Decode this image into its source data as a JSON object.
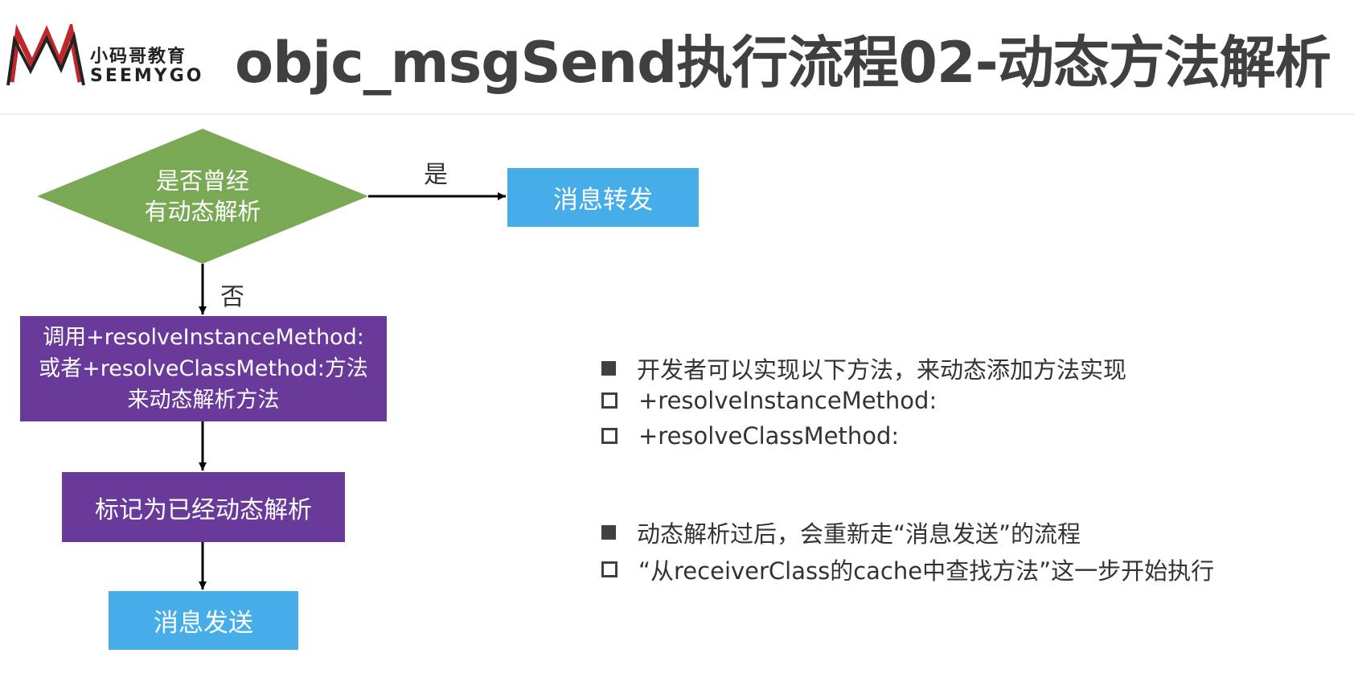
{
  "header": {
    "logo_cn": "小码哥教育",
    "logo_en": "SEEMYGO",
    "title": "objc_msgSend执行流程02-动态方法解析"
  },
  "colors": {
    "decision_green": "#7aa955",
    "process_purple": "#693a9a",
    "terminal_blue": "#46ade8",
    "logo_red": "#c0272d"
  },
  "flowchart": {
    "decision": {
      "line1": "是否曾经",
      "line2": "有动态解析"
    },
    "yes_label": "是",
    "no_label": "否",
    "forward": "消息转发",
    "resolve": {
      "line1": "调用+resolveInstanceMethod:",
      "line2": "或者+resolveClassMethod:方法",
      "line3": "来动态解析方法"
    },
    "mark": "标记为已经动态解析",
    "send": "消息发送"
  },
  "notes": {
    "group1": {
      "main": "开发者可以实现以下方法，来动态添加方法实现",
      "sub1": "+resolveInstanceMethod:",
      "sub2": "+resolveClassMethod:"
    },
    "group2": {
      "main": "动态解析过后，会重新走“消息发送”的流程",
      "sub1": "“从receiverClass的cache中查找方法”这一步开始执行"
    }
  }
}
